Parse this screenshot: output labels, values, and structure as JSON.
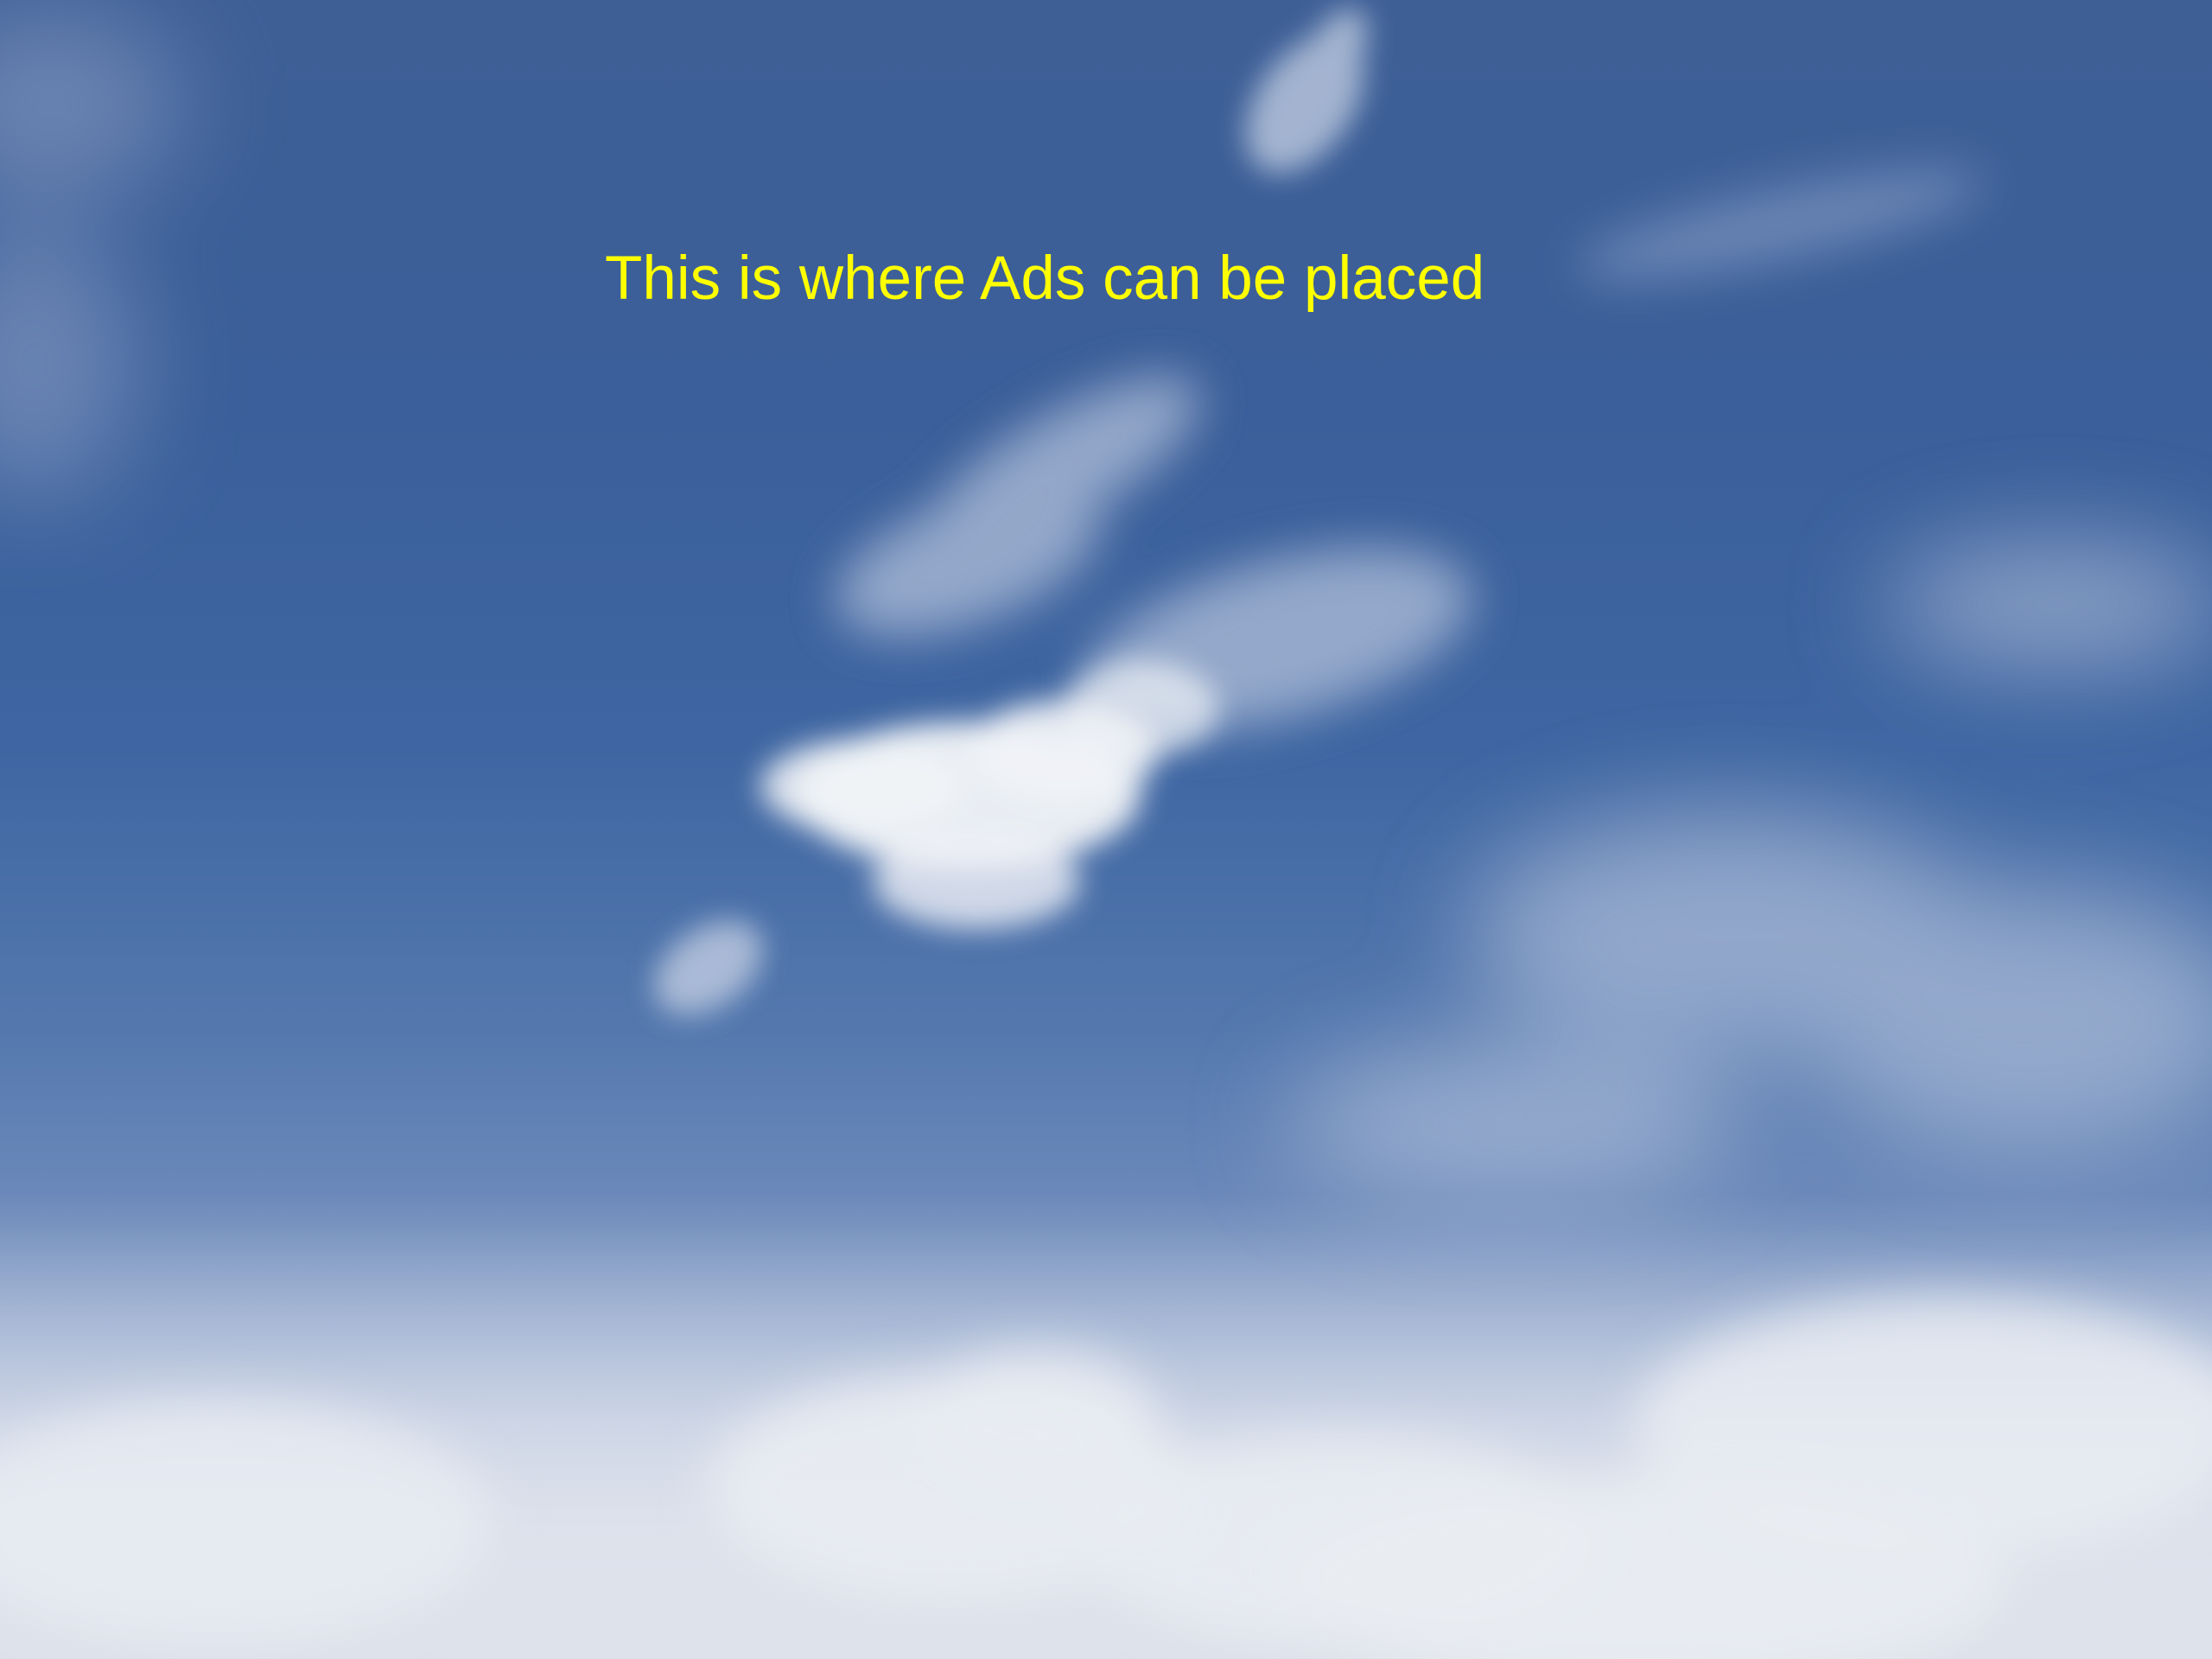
{
  "overlay": {
    "text": "This is where Ads can be placed",
    "color": "#ffff00"
  },
  "scene": {
    "sky_top": "#3e5f96",
    "sky_mid": "#3f66a2",
    "horizon": "#d6dbe6",
    "cloud": "#f1f3f7"
  }
}
